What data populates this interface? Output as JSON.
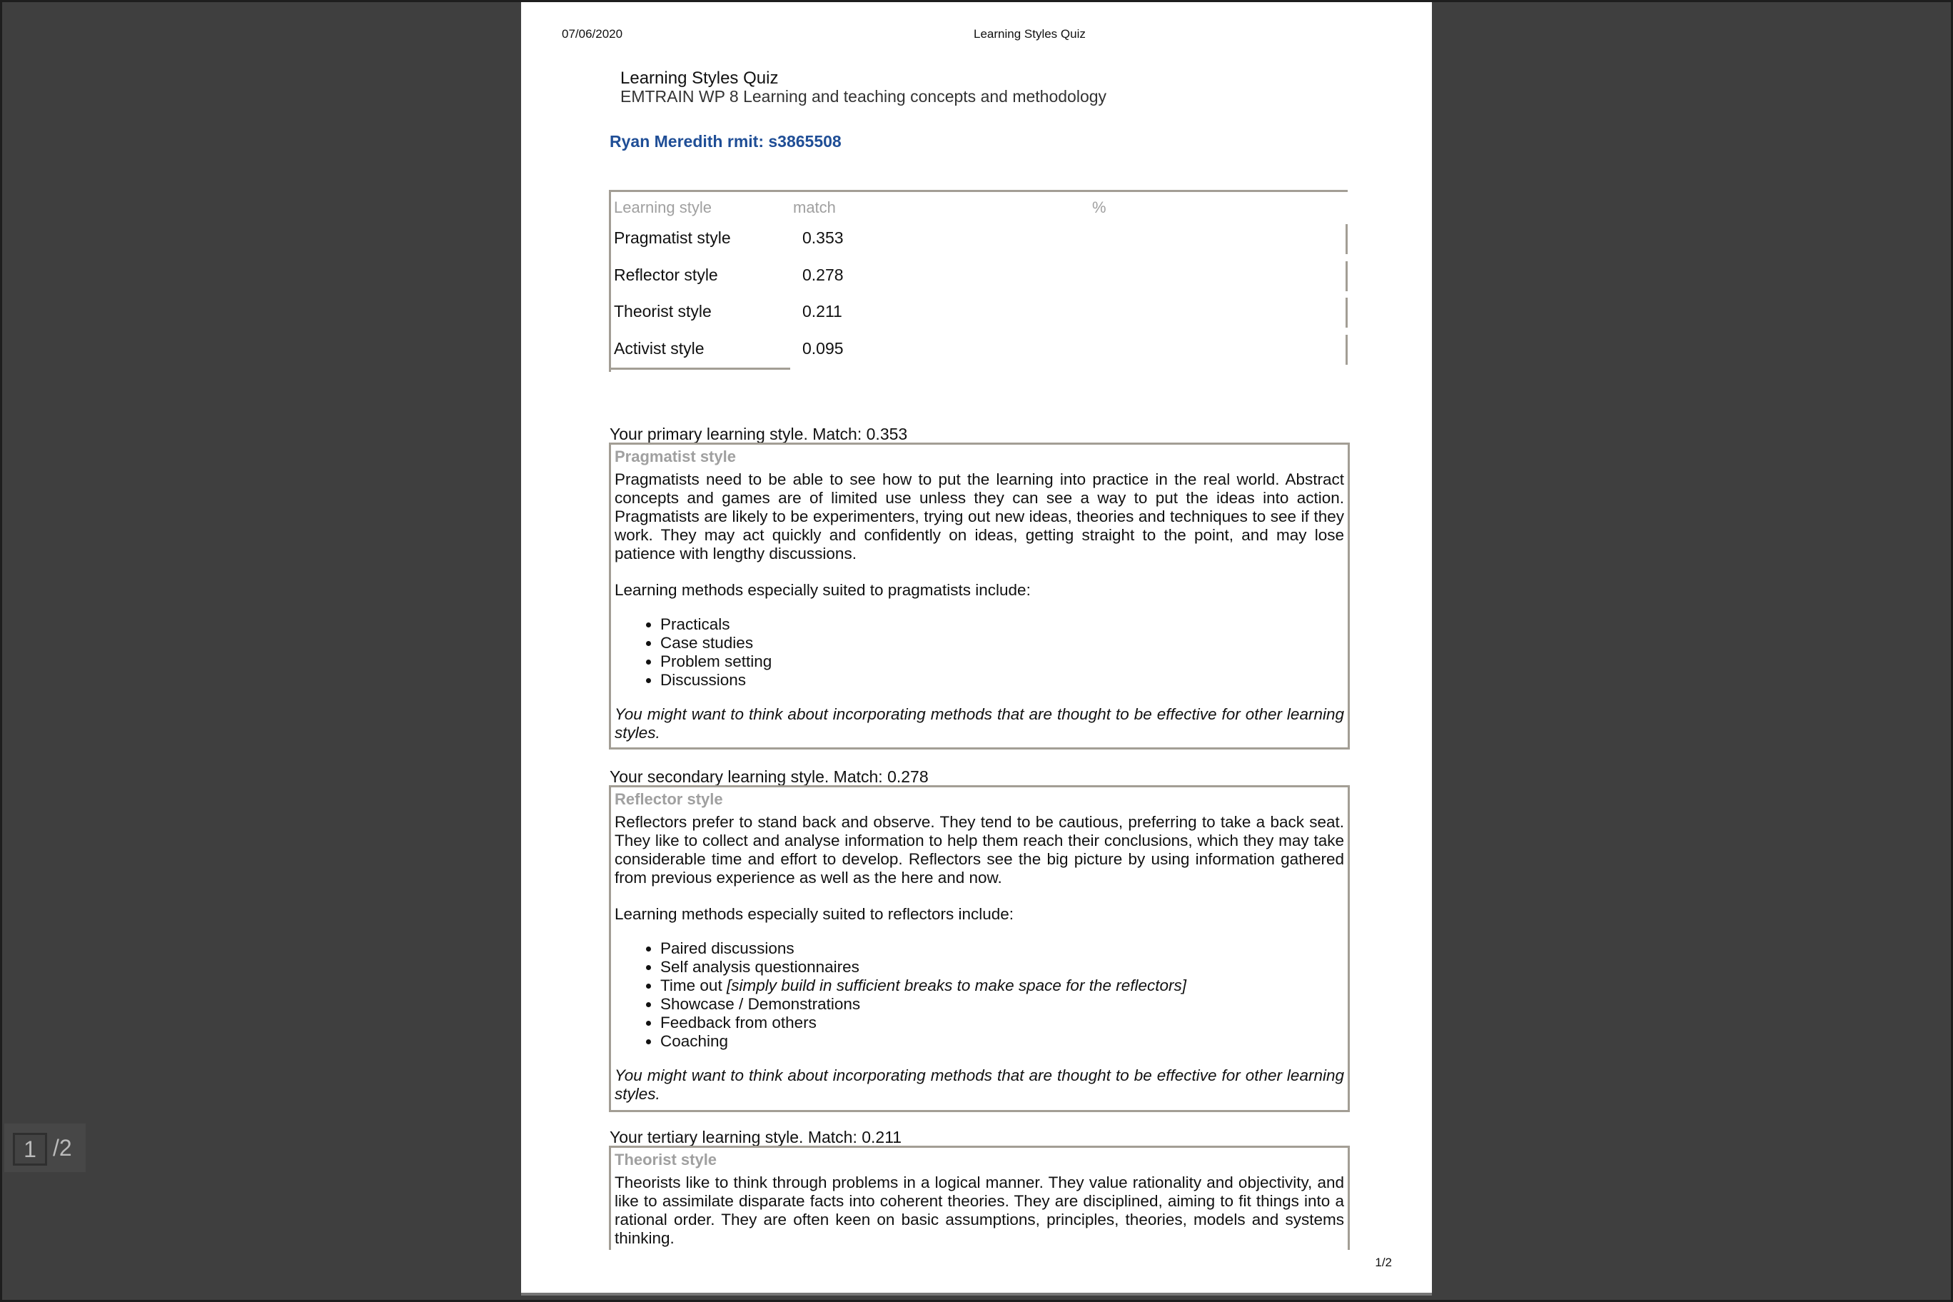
{
  "header": {
    "date": "07/06/2020",
    "title": "Learning Styles Quiz"
  },
  "footer": {
    "page": "1/2"
  },
  "quiz": {
    "title": "Learning Styles Quiz",
    "subtitle": "EMTRAIN WP 8 Learning and teaching concepts and methodology",
    "user": "Ryan Meredith rmit: s3865508"
  },
  "results": {
    "headers": {
      "style": "Learning style",
      "match": "match",
      "percent": "%"
    },
    "rows": [
      {
        "name": "Pragmatist style",
        "match": "0.353"
      },
      {
        "name": "Reflector style",
        "match": "0.278"
      },
      {
        "name": "Theorist style",
        "match": "0.211"
      },
      {
        "name": "Activist style",
        "match": "0.095"
      }
    ]
  },
  "primary": {
    "label": "Your primary learning style. Match: 0.353",
    "heading": "Pragmatist style",
    "description": "Pragmatists need to be able to see how to put the learning into practice in the real world. Abstract concepts and games are of limited use unless they can see a way to put the ideas into action. Pragmatists are likely to be experimenters, trying out new ideas, theories and techniques to see if they work. They may act quickly and confidently on ideas, getting straight to the point, and may lose patience with lengthy discussions.",
    "methods_intro": "Learning methods especially suited to pragmatists include:",
    "methods": [
      "Practicals",
      "Case studies",
      "Problem setting",
      "Discussions"
    ],
    "note": "You might want to think about incorporating methods that are thought to be effective for other learning styles."
  },
  "secondary": {
    "label": "Your secondary learning style. Match: 0.278",
    "heading": "Reflector style",
    "description": "Reflectors prefer to stand back and observe. They tend to be cautious, preferring to take a back seat. They like to collect and analyse information to help them reach their conclusions, which they may take considerable time and effort to develop. Reflectors see the big picture by using information gathered from previous experience as well as the here and now.",
    "methods_intro": "Learning methods especially suited to reflectors include:",
    "methods": [
      "Paired discussions",
      "Self analysis questionnaires",
      "Time out",
      "Showcase / Demonstrations",
      "Feedback from others",
      "Coaching"
    ],
    "methods_extra": "[simply build in sufficient breaks to make space for the reflectors]",
    "note": "You might want to think about incorporating methods that are thought to be effective for other learning styles."
  },
  "tertiary": {
    "label": "Your tertiary learning style. Match: 0.211",
    "heading": "Theorist style",
    "description": "Theorists like to think through problems in a logical manner. They value rationality and objectivity, and like to assimilate disparate facts into coherent theories. They are disciplined, aiming to fit things into a rational order. They are often keen on basic assumptions, principles, theories, models and systems thinking."
  },
  "viewer": {
    "current_page": "1",
    "total_pages": "/2"
  }
}
